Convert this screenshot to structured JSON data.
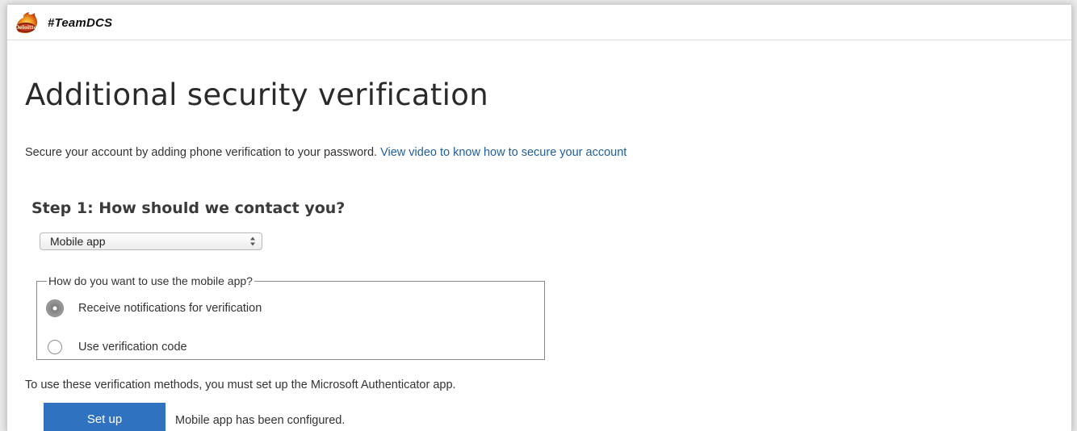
{
  "header": {
    "brand": "#TeamDCS",
    "logo_icon": "flame-logo-icon",
    "logo_text": "Deloitte"
  },
  "page": {
    "title": "Additional security verification",
    "intro_text": "Secure your account by adding phone verification to your password.",
    "intro_link": "View video to know how to secure your account"
  },
  "step1": {
    "title": "Step 1: How should we contact you?",
    "contact_method_selected": "Mobile app",
    "mobile_group": {
      "legend": "How do you want to use the mobile app?",
      "options": [
        {
          "label": "Receive notifications for verification",
          "checked": true
        },
        {
          "label": "Use verification code",
          "checked": false
        }
      ]
    },
    "note": "To use these verification methods, you must set up the Microsoft Authenticator app.",
    "setup_button": "Set up",
    "status_text": "Mobile app has been configured."
  },
  "colors": {
    "link": "#1f5f99",
    "button": "#2f72c0",
    "text": "#333333"
  }
}
